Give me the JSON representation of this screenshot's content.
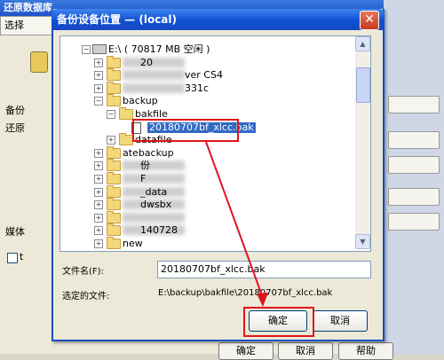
{
  "background_window": {
    "title": "还原数据库",
    "tab": "选择",
    "labels": [
      "备份",
      "还原",
      "媒体"
    ],
    "checkbox_label": "t",
    "ok": "确定",
    "cancel": "取消",
    "help": "帮助"
  },
  "dialog": {
    "title": "备份设备位置 — (local)",
    "close_symbol": "✕",
    "tree": [
      {
        "label": "E:\\ ( 70817 MB 空闲 )",
        "expander": "−",
        "level": 0
      },
      {
        "label": "20",
        "suffix": "",
        "expander": "+",
        "level": 1,
        "blurred": true
      },
      {
        "label": "",
        "suffix": "ver CS4",
        "expander": "+",
        "level": 1,
        "blurred": true
      },
      {
        "label": "",
        "suffix": "331c",
        "expander": "+",
        "level": 1,
        "blurred": true
      },
      {
        "label": "backup",
        "expander": "−",
        "level": 1
      },
      {
        "label": "bakfile",
        "expander": "−",
        "level": 2
      },
      {
        "label": "20180707bf_xlcc.bak",
        "expander": "",
        "level": 3,
        "selected": true,
        "file": true
      },
      {
        "label": "datafile",
        "expander": "+",
        "level": 2
      },
      {
        "label": "atebackup",
        "expander": "+",
        "level": 1
      },
      {
        "label": "份",
        "expander": "+",
        "level": 1,
        "blurred": true
      },
      {
        "label": "F",
        "expander": "+",
        "level": 1,
        "blurred": true
      },
      {
        "label": "_data",
        "expander": "+",
        "level": 1,
        "blurred": true
      },
      {
        "label": "dwsbx",
        "expander": "+",
        "level": 1,
        "blurred": true
      },
      {
        "label": "",
        "expander": "+",
        "level": 1,
        "blurred": true
      },
      {
        "label": "140728",
        "expander": "+",
        "level": 1,
        "blurred": true
      },
      {
        "label": "new",
        "expander": "+",
        "level": 1
      }
    ],
    "filename_label": "文件名(F):",
    "filename_value": "20180707bf_xlcc.bak",
    "selected_path_label": "选定的文件:",
    "selected_path_value": "E:\\backup\\bakfile\\20180707bf_xlcc.bak",
    "ok": "确定",
    "cancel": "取消"
  },
  "icons": [
    "close-icon",
    "folder-icon",
    "file-icon",
    "drive-icon",
    "scroll-up-icon",
    "scroll-down-icon"
  ],
  "colors": {
    "titlebar": "#0f4fd2",
    "selection": "#316ac5",
    "annotation": "#e0141c"
  }
}
